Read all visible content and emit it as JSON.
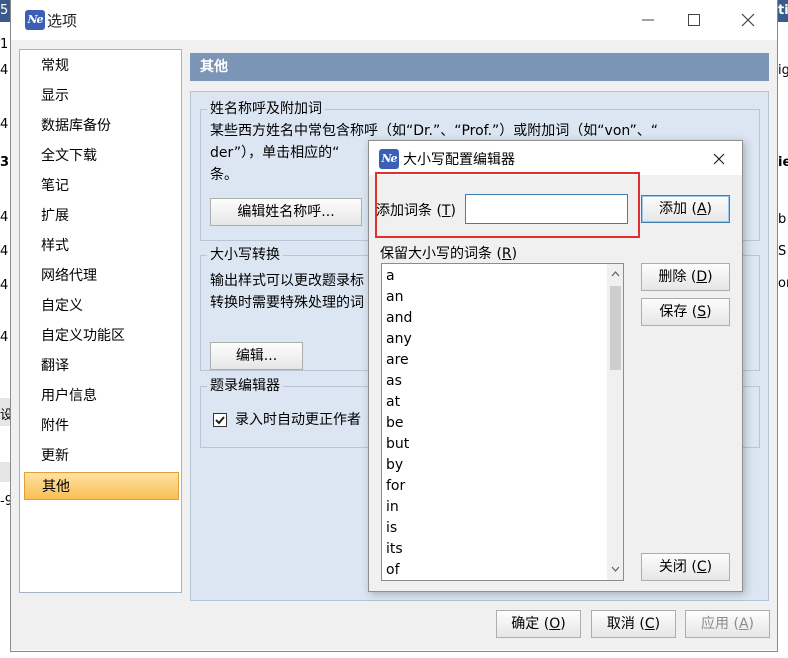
{
  "window": {
    "title": "选项",
    "icon_text": "Ne"
  },
  "background_fragments": {
    "left": [
      "5",
      "1",
      "4",
      "4",
      "3",
      "4",
      "4",
      "4",
      "4",
      "设",
      "-9"
    ],
    "right": [
      "ti",
      "ig",
      "ie",
      "b",
      "S",
      "or"
    ]
  },
  "sidebar": {
    "items": [
      {
        "label": "常规"
      },
      {
        "label": "显示"
      },
      {
        "label": "数据库备份"
      },
      {
        "label": "全文下载"
      },
      {
        "label": "笔记"
      },
      {
        "label": "扩展"
      },
      {
        "label": "样式"
      },
      {
        "label": "网络代理"
      },
      {
        "label": "自定义"
      },
      {
        "label": "自定义功能区"
      },
      {
        "label": "翻译"
      },
      {
        "label": "用户信息"
      },
      {
        "label": "附件"
      },
      {
        "label": "更新"
      },
      {
        "label": "其他"
      }
    ],
    "selected": "其他"
  },
  "panel": {
    "header": "其他",
    "name_group": {
      "title": "姓名称呼及附加词",
      "line1": "某些西方姓名中常包含称呼（如“Dr.”、“Prof.”）或附加词（如“von”、“",
      "line2": "der”），单击相应的“",
      "line3": "条。",
      "button": "编辑姓名称呼..."
    },
    "case_group": {
      "title": "大小写转换",
      "line1": "输出样式可以更改题录标",
      "line2": "转换时需要特殊处理的词",
      "button": "编辑..."
    },
    "editor_group": {
      "title": "题录编辑器",
      "checkbox_label": "录入时自动更正作者",
      "checked": true
    }
  },
  "footer": {
    "ok": "确定",
    "ok_key": "O",
    "cancel": "取消",
    "cancel_key": "C",
    "apply": "应用",
    "apply_key": "A"
  },
  "dialog": {
    "title": "大小写配置编辑器",
    "add_label": "添加词条",
    "add_key": "T",
    "add_value": "",
    "add_button": "添加",
    "add_button_key": "A",
    "list_label": "保留大小写的词条",
    "list_key": "R",
    "delete_button": "删除",
    "delete_key": "D",
    "save_button": "保存",
    "save_key": "S",
    "close_button": "关闭",
    "close_key": "C",
    "words": [
      "a",
      "an",
      "and",
      "any",
      "are",
      "as",
      "at",
      "be",
      "but",
      "by",
      "for",
      "in",
      "is",
      "its",
      "of"
    ]
  },
  "colors": {
    "panel_header": "#7b95b6",
    "panel_bg": "#dce6f2",
    "selected_item": "#f7bf55",
    "highlight_box": "#e03030",
    "focus_border": "#3c7fb1",
    "app_icon": "#3a5fb4"
  }
}
